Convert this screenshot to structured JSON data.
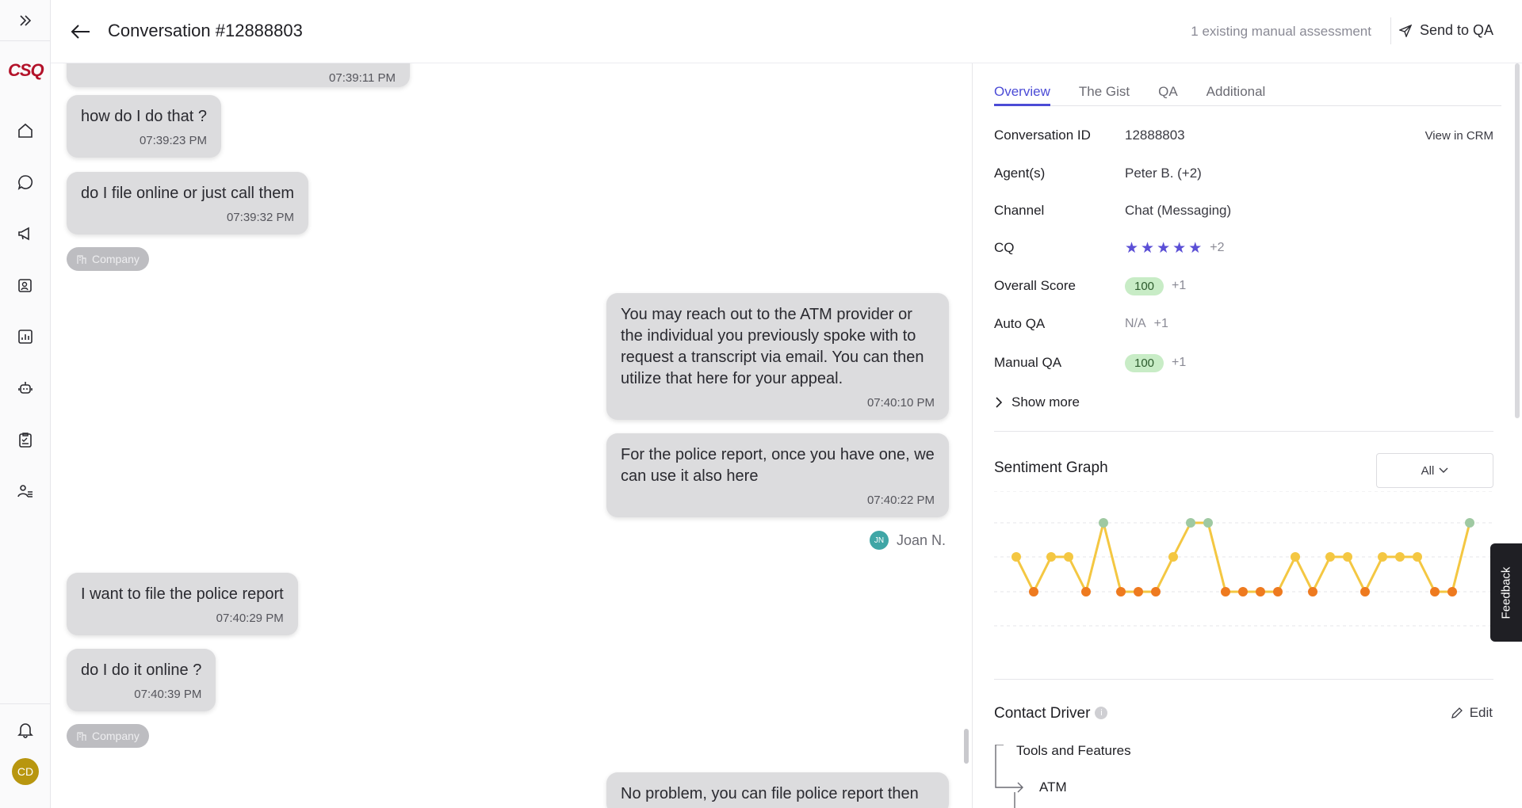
{
  "rail": {
    "logo": "CSQ",
    "nav": [
      "home-icon",
      "chat-bubble-icon",
      "megaphone-icon",
      "profile-card-icon",
      "bar-chart-icon",
      "robot-icon",
      "clipboard-icon",
      "team-icon"
    ],
    "avatar": "CD"
  },
  "header": {
    "title": "Conversation #12888803",
    "assessment": "1 existing manual assessment",
    "send_label": "Send to QA"
  },
  "chat": {
    "top_time": "07:39:11 PM",
    "messages": [
      {
        "text": "how do I do that ?",
        "time": "07:39:23 PM"
      },
      {
        "text": "do I file online or just call them",
        "time": "07:39:32 PM"
      },
      {
        "text": "You may reach out to the ATM provider or the individual you previously spoke with to request a transcript via email. You can then utilize that here for your appeal.",
        "time": "07:40:10 PM"
      },
      {
        "text": "For the police report, once you have one, we can use it also here",
        "time": "07:40:22 PM"
      },
      {
        "text": "I want to file the police report",
        "time": "07:40:29 PM"
      },
      {
        "text": "do I do it online ?",
        "time": "07:40:39 PM"
      },
      {
        "text": "No problem, you can file police report then",
        "time": ""
      }
    ],
    "company_pill": "Company",
    "agent_initials": "JN",
    "agent_name": "Joan N."
  },
  "panel": {
    "tabs": [
      "Overview",
      "The Gist",
      "QA",
      "Additional"
    ],
    "conversation_id": {
      "label": "Conversation ID",
      "value": "12888803",
      "link": "View in CRM"
    },
    "agents": {
      "label": "Agent(s)",
      "value": "Peter B. (+2)"
    },
    "channel": {
      "label": "Channel",
      "value": "Chat (Messaging)"
    },
    "cq": {
      "label": "CQ",
      "stars": 5,
      "extra": "+2"
    },
    "overall": {
      "label": "Overall Score",
      "value": "100",
      "extra": "+1"
    },
    "auto_qa": {
      "label": "Auto QA",
      "value": "N/A",
      "extra": "+1"
    },
    "manual_qa": {
      "label": "Manual QA",
      "value": "100",
      "extra": "+1"
    },
    "show_more": "Show more",
    "sentiment_title": "Sentiment Graph",
    "sentiment_filter": "All",
    "contact_driver_title": "Contact Driver",
    "edit_label": "Edit",
    "driver_tree": [
      "Tools and Features",
      "ATM"
    ]
  },
  "sentiment": {
    "levels": [
      0,
      -1,
      0,
      0,
      -1,
      1,
      -1,
      -1,
      -1,
      0,
      1,
      1,
      -1,
      -1,
      -1,
      -1,
      0,
      -1,
      0,
      0,
      -1,
      0,
      0,
      0,
      -1,
      -1,
      1
    ]
  },
  "colors": {
    "accent": "#4b4bd6",
    "positive": "#9fc9a2",
    "neutral": "#f4c742",
    "negative": "#ee7a1f"
  },
  "feedback_label": "Feedback"
}
